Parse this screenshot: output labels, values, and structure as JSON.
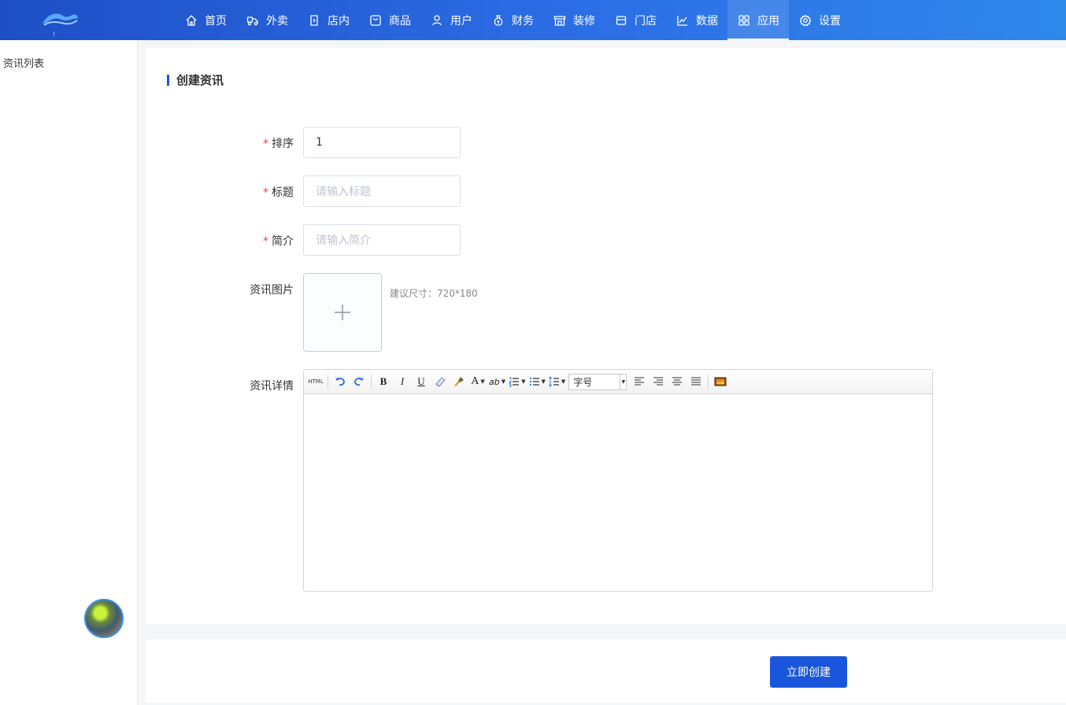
{
  "header": {
    "nav": [
      {
        "label": "首页",
        "icon": "home-icon"
      },
      {
        "label": "外卖",
        "icon": "delivery-icon"
      },
      {
        "label": "店内",
        "icon": "dine-in-icon"
      },
      {
        "label": "商品",
        "icon": "goods-icon"
      },
      {
        "label": "用户",
        "icon": "user-icon"
      },
      {
        "label": "财务",
        "icon": "money-bag-icon"
      },
      {
        "label": "装修",
        "icon": "store-decor-icon"
      },
      {
        "label": "门店",
        "icon": "store-icon"
      },
      {
        "label": "数据",
        "icon": "chart-icon"
      },
      {
        "label": "应用",
        "icon": "apps-icon"
      },
      {
        "label": "设置",
        "icon": "gear-icon"
      }
    ],
    "active": "应用"
  },
  "sidebar": {
    "items": [
      {
        "label": "资讯列表"
      }
    ]
  },
  "form": {
    "title": "创建资讯",
    "required_mark": "*",
    "sort": {
      "label": "排序",
      "value": "1"
    },
    "title_field": {
      "label": "标题",
      "placeholder": "请输入标题"
    },
    "intro": {
      "label": "简介",
      "placeholder": "请输入简介"
    },
    "image": {
      "label": "资讯图片",
      "hint": "建议尺寸：720*180"
    },
    "detail": {
      "label": "资讯详情"
    }
  },
  "editor": {
    "html_label": "HTML",
    "bold": "B",
    "italic": "I",
    "underline": "U",
    "font_color": "A",
    "bg_color": "ab",
    "font_size_label": "字号"
  },
  "footer": {
    "submit_label": "立即创建"
  },
  "colors": {
    "primary": "#1a56db",
    "header_start": "#1e4fc7",
    "header_end": "#2e88ea",
    "required": "#e84343"
  }
}
